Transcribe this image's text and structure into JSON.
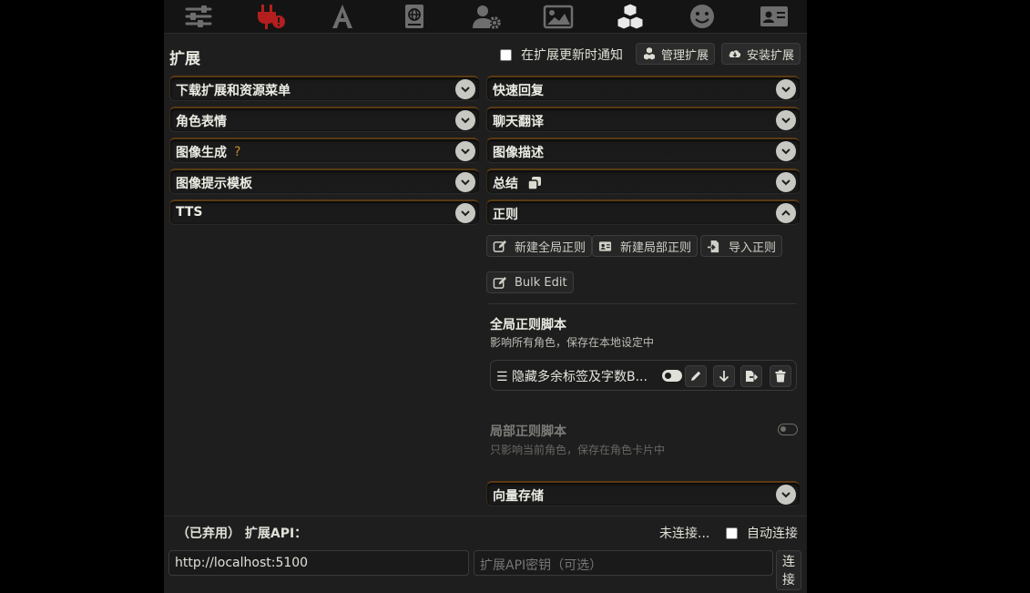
{
  "topbar": {
    "icons": [
      "sliders-icon",
      "plug-alert-icon",
      "font-icon",
      "book-atlas-icon",
      "user-gear-icon",
      "image-icon",
      "cubes-icon",
      "smile-icon",
      "id-card-icon"
    ],
    "active_color": "#b41e1e"
  },
  "header": {
    "title": "扩展",
    "notify_label": "在扩展更新时通知",
    "manage_label": "管理扩展",
    "install_label": "安装扩展"
  },
  "left_drawers": [
    {
      "label": "下载扩展和资源菜单"
    },
    {
      "label": "角色表情"
    },
    {
      "label": "图像生成",
      "hint": "?"
    },
    {
      "label": "图像提示模板"
    },
    {
      "label": "TTS"
    }
  ],
  "right_drawers": [
    {
      "label": "快速回复"
    },
    {
      "label": "聊天翻译"
    },
    {
      "label": "图像描述"
    },
    {
      "label": "总结"
    },
    {
      "label": "正则"
    }
  ],
  "regex": {
    "new_global": "新建全局正则",
    "new_local": "新建局部正则",
    "import": "导入正则",
    "bulk_edit": "Bulk Edit",
    "global_title": "全局正则脚本",
    "global_sub": "影响所有角色，保存在本地设定中",
    "script_name": "☰ 隐藏多余标签及字数B...",
    "local_title": "局部正则脚本",
    "local_sub": "只影响当前角色，保存在角色卡片中"
  },
  "vector_drawer": {
    "label": "向量存储"
  },
  "api": {
    "label": "（已弃用） 扩展API：",
    "status": "未连接...",
    "auto_connect": "自动连接",
    "url_value": "http://localhost:5100",
    "key_placeholder": "扩展API密钥（可选）",
    "connect_label": "连接"
  },
  "colors": {
    "accent": "#7a4a12",
    "panel": "#1e1e1e",
    "hint": "#c88a2a"
  }
}
